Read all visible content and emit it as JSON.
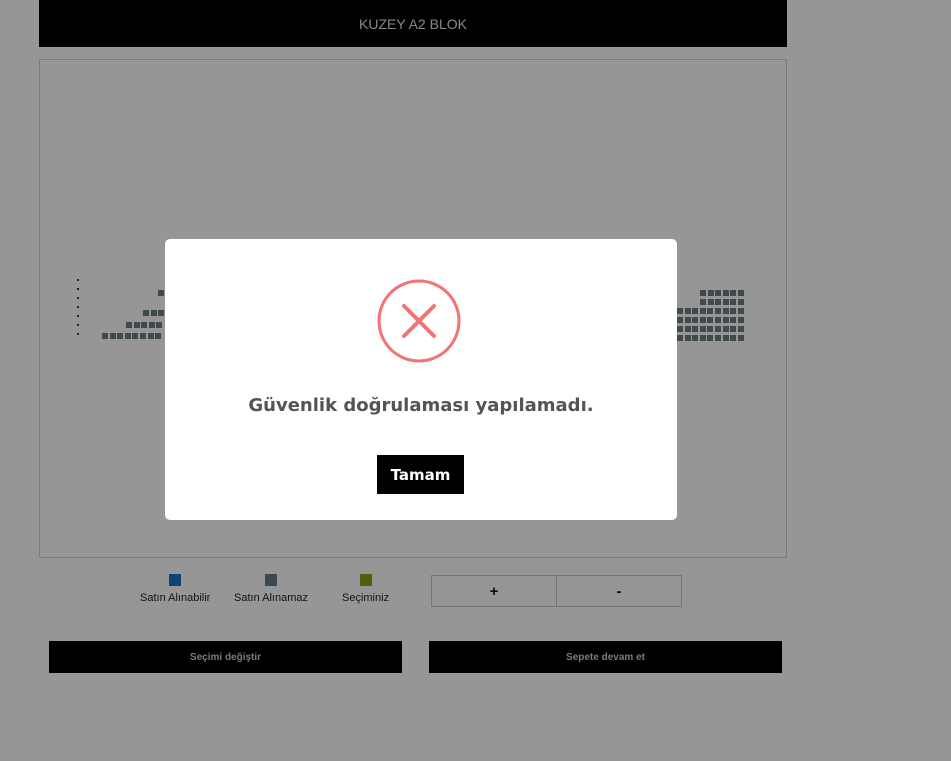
{
  "block": {
    "title": "KUZEY A2 BLOK"
  },
  "legend": [
    {
      "label": "Satın Alınabilir",
      "color": "#1a73c4"
    },
    {
      "label": "Satın Alınamaz",
      "color": "#6b7a85"
    },
    {
      "label": "Seçiminiz",
      "color": "#8fa11a"
    }
  ],
  "quantity": {
    "plus": "+",
    "minus": "-"
  },
  "actions": {
    "change_selection": "Seçimi değiştir",
    "continue_to_cart": "Sepete devam et"
  },
  "dialog": {
    "icon": "error-x-icon",
    "icon_color": "#f27474",
    "message": "Güvenlik doğrulaması yapılamadı.",
    "ok_label": "Tamam"
  }
}
